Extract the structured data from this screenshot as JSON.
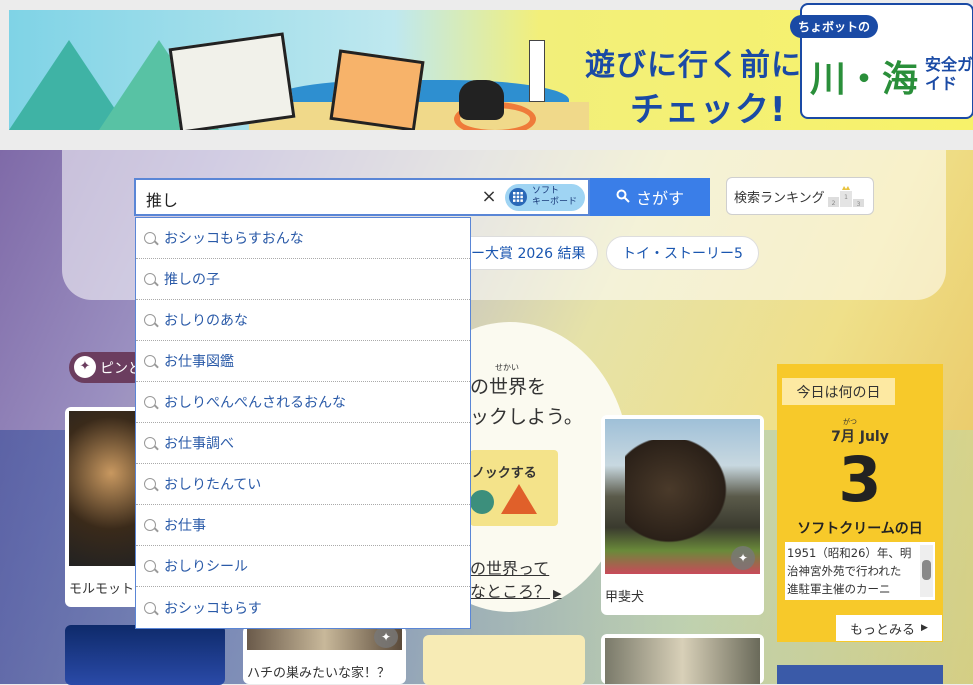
{
  "banner": {
    "copy_line1": "遊びに行く前に",
    "copy_line2": "チェック!",
    "guide_tag": "ちょボットの",
    "guide_title": "川・海",
    "guide_sub": "安全ガイド"
  },
  "search": {
    "query": "推し",
    "clear_icon": "×",
    "keyboard_label": "ソフト\nキーボード",
    "submit_label": "さがす",
    "ranking_label": "検索ランキング",
    "ranking_podium": [
      "2",
      "1",
      "3"
    ]
  },
  "suggestions": [
    "おシッコもらすおんな",
    "推しの子",
    "おしりのあな",
    "お仕事図鑑",
    "おしりぺんぺんされるおんな",
    "お仕事調べ",
    "おしりたんてい",
    "お仕事",
    "おしりシール",
    "おシッコもらす"
  ],
  "chips": [
    "ー大賞 2026 結果",
    "トイ・ストーリー5"
  ],
  "pin": {
    "label": "ピンど"
  },
  "feature": {
    "ruby": "せかい",
    "line1": "の世界を",
    "line2": "ックしよう。",
    "knock_label": "ノックする",
    "link1": "の世界って",
    "link2": "なところ？"
  },
  "cards": {
    "mormot_caption": "モルモット",
    "dog_caption": "甲斐犬",
    "b2_caption": "ハチの巣みたいな家！？"
  },
  "today": {
    "header": "今日は何の日",
    "ruby": "がつ",
    "month": "7月 July",
    "day": "3",
    "title": "ソフトクリームの日",
    "description": "1951（昭和26）年、明治神宮外苑で行われた進駐軍主催のカーニ",
    "more_label": "もっとみる"
  },
  "colors": {
    "accent": "#3a7ee8",
    "link": "#2a5aa8",
    "today_bg": "#f7c92a"
  }
}
